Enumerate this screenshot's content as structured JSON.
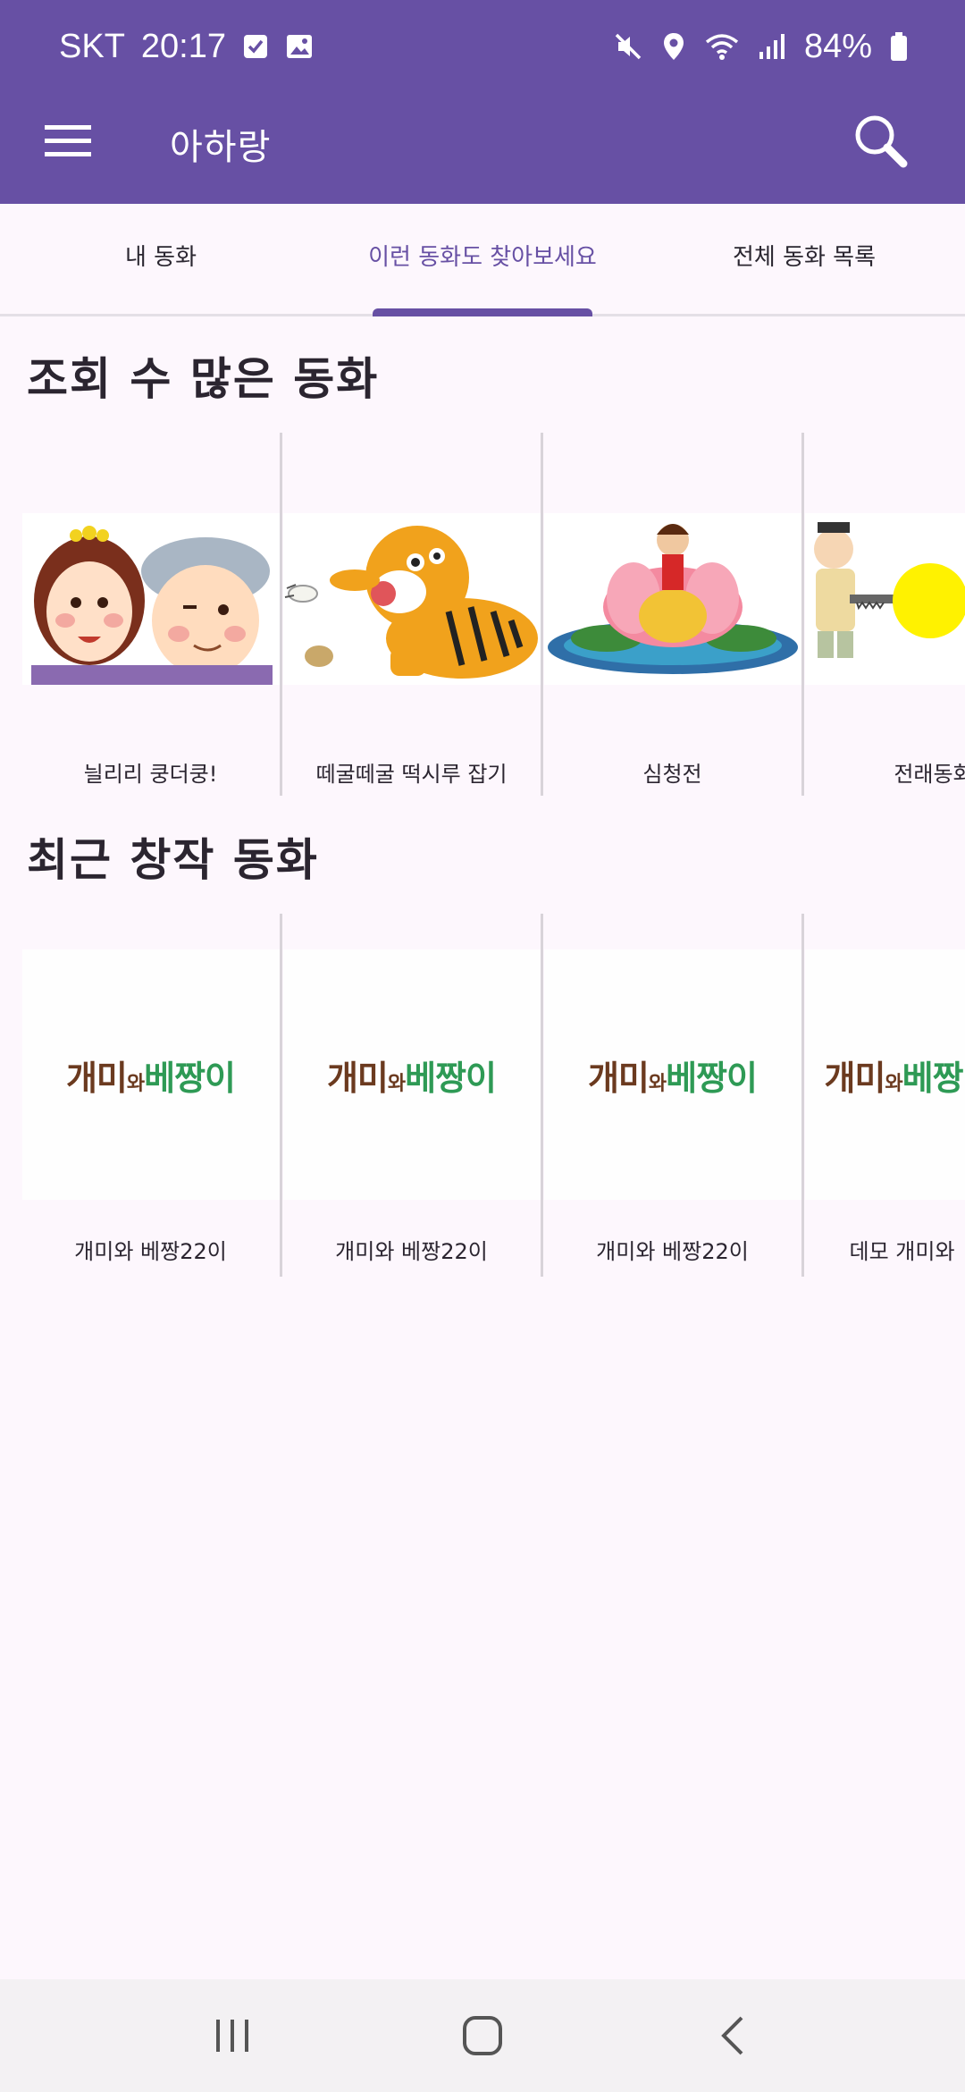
{
  "status_bar": {
    "carrier": "SKT",
    "time": "20:17",
    "battery": "84%"
  },
  "app_bar": {
    "title": "아하랑",
    "menu_icon": "menu-icon",
    "search_icon": "search-icon"
  },
  "tabs": [
    {
      "label": "내 동화",
      "active": false
    },
    {
      "label": "이런 동화도 찾아보세요",
      "active": true
    },
    {
      "label": "전체 동화 목록",
      "active": false
    }
  ],
  "popular": {
    "title": "조회 수 많은 동화",
    "items": [
      {
        "label": "늴리리 쿵더쿵!"
      },
      {
        "label": "떼굴떼굴 떡시루 잡기"
      },
      {
        "label": "심청전"
      },
      {
        "label": "전래동화"
      }
    ]
  },
  "recent": {
    "title": "최근 창작 동화",
    "logo": {
      "part1": "개미",
      "part2": "와",
      "part3": "베짱이"
    },
    "items": [
      {
        "label": "개미와 베짱22이"
      },
      {
        "label": "개미와 베짱22이"
      },
      {
        "label": "개미와 베짱22이"
      },
      {
        "label": "데모 개미와"
      }
    ]
  },
  "colors": {
    "primary": "#6750A4",
    "background": "#FDF7FD"
  }
}
